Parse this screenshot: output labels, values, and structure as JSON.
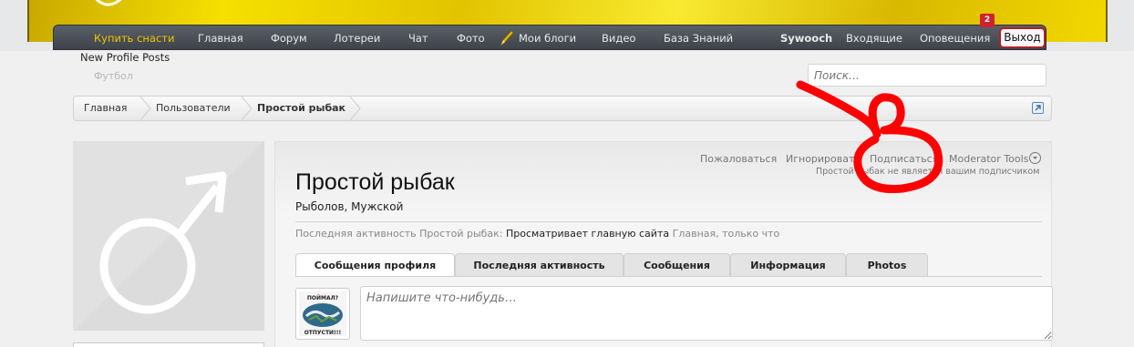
{
  "nav": {
    "items": [
      "Купить снасти",
      "Главная",
      "Форум",
      "Лотереи",
      "Чат",
      "Фото",
      "Мои блоги",
      "Видео",
      "База Знаний"
    ],
    "user": "Sywooch",
    "inbox": "Входящие",
    "alerts": "Оповещения",
    "alerts_count": "2",
    "logout": "Выход"
  },
  "subnav": {
    "new_profile_posts": "New Profile Posts",
    "faded": "Футбол"
  },
  "search": {
    "placeholder": "Поиск…"
  },
  "breadcrumb": [
    "Главная",
    "Пользователи",
    "Простой рыбак"
  ],
  "profile": {
    "actions": [
      "Пожаловаться",
      "Игнорировать",
      "Подписаться",
      "Moderator Tools"
    ],
    "subscription_status": "Простой рыбак не является вашим подписчиком",
    "username": "Простой рыбак",
    "usertitle": "Рыболов, Мужской",
    "last_activity": {
      "prefix": "Последняя активность Простой рыбак:",
      "action": "Просматривает главную сайта",
      "location": "Главная",
      "time": ", только что"
    },
    "tabs": [
      "Сообщения профиля",
      "Последняя активность",
      "Сообщения",
      "Информация",
      "Photos"
    ],
    "composer_placeholder": "Напишите что-нибудь…",
    "mini_avatar_text": [
      "ПОЙМАЛ?",
      "ОТПУСТИ!!!"
    ]
  },
  "colors": {
    "nav_bg": "#464b52",
    "active_nav": "#f0c400",
    "annotation": "#ff0000"
  }
}
